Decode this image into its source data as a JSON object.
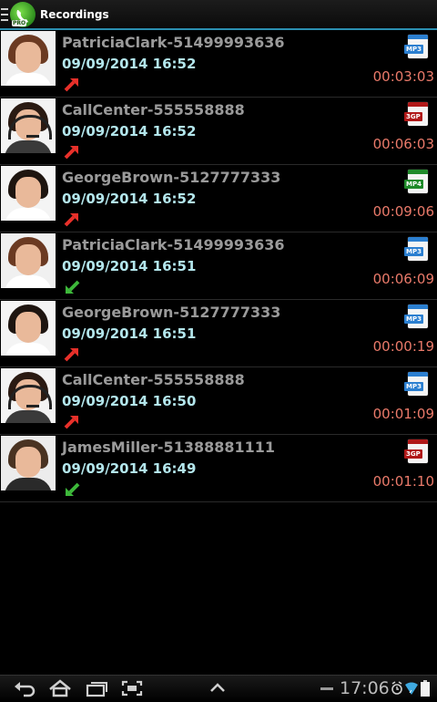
{
  "app": {
    "title": "Recordings",
    "icon": "pro-call-recorder-icon",
    "icon_badge": "PRO"
  },
  "recordings": [
    {
      "name": "PatriciaClark-51499993636",
      "date": "09/09/2014 16:52",
      "direction": "outgoing",
      "duration": "00:03:03",
      "format": "MP3",
      "avatar": "woman-smiling"
    },
    {
      "name": "CallCenter-555558888",
      "date": "09/09/2014 16:52",
      "direction": "outgoing",
      "duration": "00:06:03",
      "format": "3GP",
      "avatar": "woman-headset"
    },
    {
      "name": "GeorgeBrown-5127777333",
      "date": "09/09/2014 16:52",
      "direction": "outgoing",
      "duration": "00:09:06",
      "format": "MP4",
      "avatar": "man-smiling"
    },
    {
      "name": "PatriciaClark-51499993636",
      "date": "09/09/2014 16:51",
      "direction": "incoming",
      "duration": "00:06:09",
      "format": "MP3",
      "avatar": "woman-smiling"
    },
    {
      "name": "GeorgeBrown-5127777333",
      "date": "09/09/2014 16:51",
      "direction": "outgoing",
      "duration": "00:00:19",
      "format": "MP3",
      "avatar": "man-smiling"
    },
    {
      "name": "CallCenter-555558888",
      "date": "09/09/2014 16:50",
      "direction": "outgoing",
      "duration": "00:01:09",
      "format": "MP3",
      "avatar": "woman-headset"
    },
    {
      "name": "JamesMiller-51388881111",
      "date": "09/09/2014 16:49",
      "direction": "incoming",
      "duration": "00:01:10",
      "format": "3GP",
      "avatar": "man-laughing"
    }
  ],
  "colors": {
    "accent": "#2b8fb0",
    "name_text": "#9a9a9a",
    "date_text": "#b3e6ec",
    "duration_text": "#ea7a6a",
    "outgoing_arrow": "#e8302a",
    "incoming_arrow": "#3db83a",
    "mp3": "#2b7fd0",
    "3gp": "#b01818",
    "mp4": "#1f8a2a"
  },
  "status_bar": {
    "time": "17:06"
  }
}
